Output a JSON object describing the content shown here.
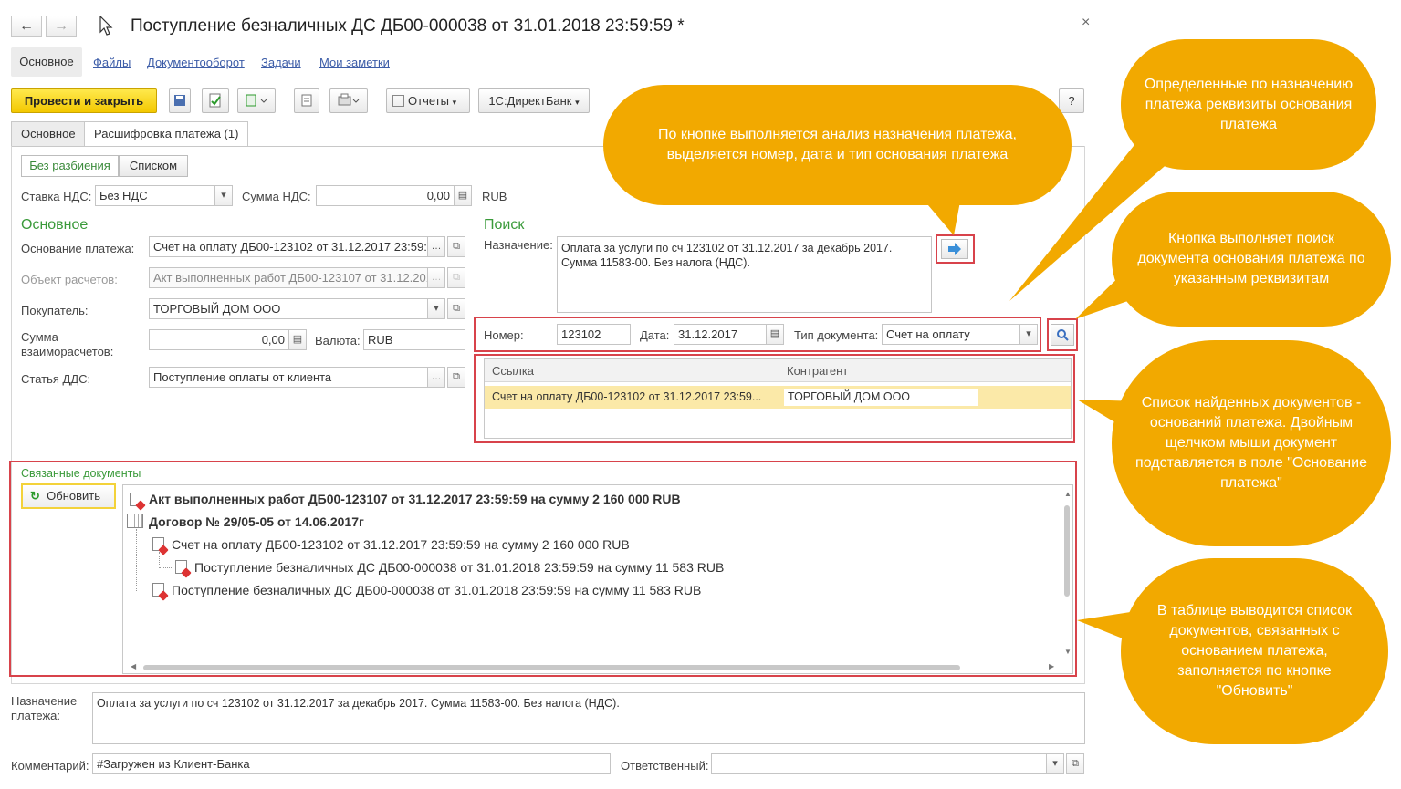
{
  "window": {
    "title": "Поступление безналичных ДС ДБ00-000038 от 31.01.2018 23:59:59 *",
    "back_icon": "arrow-left-icon",
    "forward_icon": "arrow-right-icon",
    "close_symbol": "×"
  },
  "nav_links": [
    "Основное",
    "Файлы",
    "Документооборот",
    "Задачи",
    "Мои заметки"
  ],
  "toolbar": {
    "post_close": "Провести и закрыть",
    "reports": "Отчеты",
    "directbank": "1С:ДиректБанк",
    "help": "?"
  },
  "tabs": [
    "Основное",
    "Расшифровка платежа (1)"
  ],
  "split_mode": [
    "Без разбиения",
    "Списком"
  ],
  "vat": {
    "rate_label": "Ставка НДС:",
    "rate_value": "Без НДС",
    "sum_label": "Сумма НДС:",
    "sum_value": "0,00",
    "currency": "RUB"
  },
  "main_section": {
    "title": "Основное",
    "basis_label": "Основание платежа:",
    "basis_value": "Счет на оплату ДБ00-123102 от 31.12.2017 23:59:5",
    "object_label": "Объект расчетов:",
    "object_value": "Акт выполненных работ ДБ00-123107 от 31.12.201",
    "buyer_label": "Покупатель:",
    "buyer_value": "ТОРГОВЫЙ ДОМ ООО",
    "sum_label_1": "Сумма",
    "sum_label_2": "взаиморасчетов:",
    "sum_value": "0,00",
    "currency_label": "Валюта:",
    "currency_value": "RUB",
    "dds_label": "Статья ДДС:",
    "dds_value": "Поступление оплаты от клиента"
  },
  "search_section": {
    "title": "Поиск",
    "purpose_label": "Назначение:",
    "purpose_line1": "Оплата за услуги по сч 123102 от 31.12.2017 за декабрь 2017.",
    "purpose_line2": "Сумма 11583-00. Без налога (НДС).",
    "number_label": "Номер:",
    "number_value": "123102",
    "date_label": "Дата:",
    "date_value": "31.12.2017",
    "doctype_label": "Тип документа:",
    "doctype_value": "Счет на оплату",
    "grid_headers": [
      "Ссылка",
      "Контрагент"
    ],
    "grid_rows": [
      {
        "link": "Счет на оплату ДБ00-123102 от 31.12.2017 23:59...",
        "counterparty": "ТОРГОВЫЙ ДОМ ООО"
      }
    ]
  },
  "related": {
    "title": "Связанные документы",
    "refresh": "Обновить",
    "rows": [
      "Акт выполненных работ ДБ00-123107 от 31.12.2017 23:59:59 на сумму 2 160 000 RUB",
      "Договор № 29/05-05 от 14.06.2017г",
      "Счет на оплату ДБ00-123102 от 31.12.2017 23:59:59 на сумму 2 160 000 RUB",
      "Поступление безналичных ДС ДБ00-000038 от 31.01.2018 23:59:59 на сумму 11 583 RUB",
      "Поступление безналичных ДС ДБ00-000038 от 31.01.2018 23:59:59 на сумму 11 583 RUB"
    ]
  },
  "bottom": {
    "purpose_label_1": "Назначение",
    "purpose_label_2": "платежа:",
    "purpose_value": "Оплата за услуги по сч 123102 от 31.12.2017 за декабрь 2017. Сумма 11583-00. Без налога (НДС).",
    "comment_label": "Комментарий:",
    "comment_value": "#Загружен из Клиент-Банка",
    "responsible_label": "Ответственный:",
    "responsible_value": ""
  },
  "callouts": {
    "analyze": "По кнопке выполняется анализ назначения платежа, выделяется номер, дата и тип основания платежа",
    "requisites": "Определенные по назначению платежа реквизиты основания платежа",
    "search_btn": "Кнопка выполняет поиск документа основания платежа по указанным реквизитам",
    "found_list": "Список найденных документов - оснований платежа. Двойным щелчком мыши документ подставляется в поле \"Основание платежа\"",
    "related_table": "В таблице выводится список документов, связанных с основанием платежа, заполняется по кнопке \"Обновить\""
  },
  "colors": {
    "accent_yellow": "#f3c800",
    "callout": "#f2a900",
    "highlight_red": "#d8434b",
    "section_green": "#3a9a3a",
    "selected_row": "#fbe9a8"
  }
}
